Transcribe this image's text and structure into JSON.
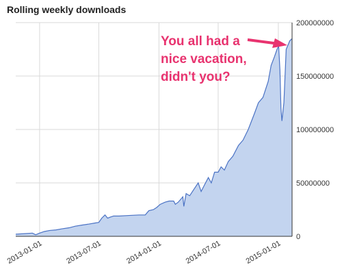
{
  "chart_data": {
    "type": "area",
    "title": "Rolling weekly downloads",
    "xlabel": "",
    "ylabel": "",
    "x_range": [
      "2012-10-20",
      "2015-02-12"
    ],
    "ylim": [
      0,
      200000000
    ],
    "y_ticks": [
      0,
      50000000,
      100000000,
      150000000,
      200000000
    ],
    "y_tick_labels": [
      "0",
      "50000000",
      "100000000",
      "150000000",
      "200000000"
    ],
    "x_ticks": [
      "2013-01-01",
      "2013-07-01",
      "2014-01-01",
      "2014-07-01",
      "2015-01-01"
    ],
    "x_tick_labels": [
      "2013-01-01",
      "2013-07-01",
      "2014-01-01",
      "2014-07-01",
      "2015-01-01"
    ],
    "grid": true,
    "legend": "none",
    "fill_color": "#c3d4ef",
    "line_color": "#4a72c4",
    "annotation": {
      "lines": [
        "You all had a",
        "nice vacation,",
        "didn't you?"
      ],
      "color": "#e8336f"
    },
    "series": [
      {
        "x": [
          "2012-10-20",
          "2012-11-15",
          "2012-12-10",
          "2012-12-20",
          "2013-01-01",
          "2013-01-15",
          "2013-02-01",
          "2013-02-20",
          "2013-03-10",
          "2013-04-01",
          "2013-04-20",
          "2013-05-10",
          "2013-06-01",
          "2013-06-20",
          "2013-07-01",
          "2013-07-10",
          "2013-07-20",
          "2013-07-28",
          "2013-08-05",
          "2013-08-15",
          "2013-09-01",
          "2013-10-01",
          "2013-11-01",
          "2013-11-20",
          "2013-12-01",
          "2013-12-15",
          "2013-12-25",
          "2014-01-05",
          "2014-01-20",
          "2014-02-01",
          "2014-02-15",
          "2014-02-20",
          "2014-03-01",
          "2014-03-15",
          "2014-03-18",
          "2014-03-25",
          "2014-04-05",
          "2014-04-20",
          "2014-05-01",
          "2014-05-10",
          "2014-05-20",
          "2014-06-01",
          "2014-06-10",
          "2014-06-20",
          "2014-07-01",
          "2014-07-10",
          "2014-07-20",
          "2014-08-01",
          "2014-08-15",
          "2014-09-01",
          "2014-09-15",
          "2014-10-01",
          "2014-10-20",
          "2014-11-01",
          "2014-11-15",
          "2014-12-01",
          "2014-12-10",
          "2014-12-20",
          "2014-12-28",
          "2015-01-02",
          "2015-01-06",
          "2015-01-09",
          "2015-01-12",
          "2015-01-18",
          "2015-01-25",
          "2015-02-05",
          "2015-02-12"
        ],
        "y": [
          2000000,
          2500000,
          3000000,
          1500000,
          3000000,
          4500000,
          5500000,
          6000000,
          7000000,
          8000000,
          9500000,
          10500000,
          11500000,
          12500000,
          13000000,
          17000000,
          20000000,
          17000000,
          18000000,
          19000000,
          19000000,
          19500000,
          20000000,
          20000000,
          24000000,
          25000000,
          27000000,
          30000000,
          32000000,
          33000000,
          33000000,
          30000000,
          32000000,
          37000000,
          28000000,
          40000000,
          38000000,
          45000000,
          50000000,
          42000000,
          48000000,
          55000000,
          50000000,
          60000000,
          60000000,
          65000000,
          62000000,
          70000000,
          75000000,
          85000000,
          90000000,
          100000000,
          115000000,
          125000000,
          130000000,
          145000000,
          160000000,
          168000000,
          175000000,
          178000000,
          155000000,
          120000000,
          108000000,
          125000000,
          175000000,
          183000000,
          185000000
        ]
      }
    ]
  }
}
